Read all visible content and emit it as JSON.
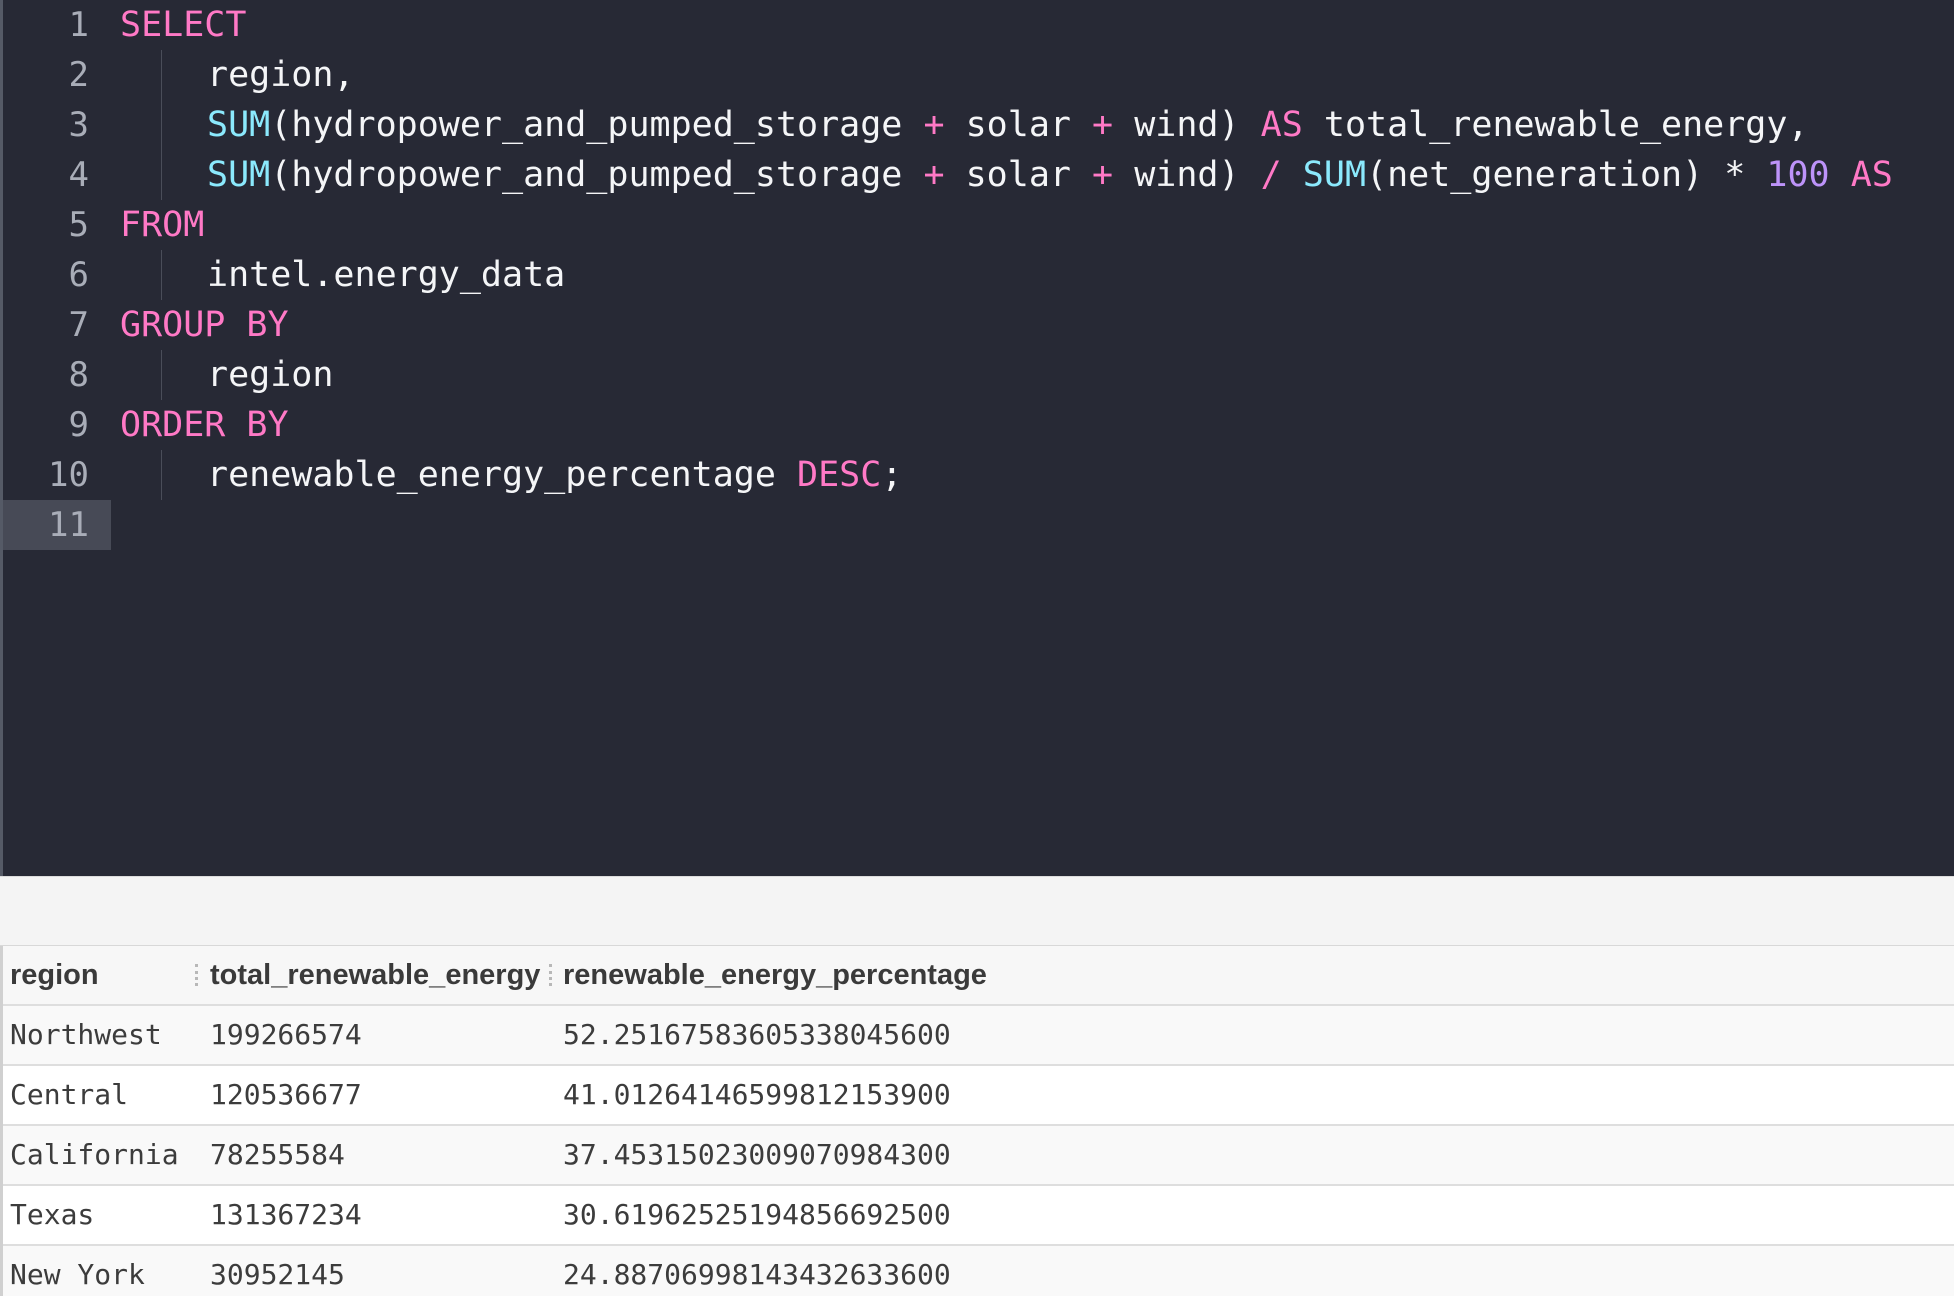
{
  "editor": {
    "active_line": 11,
    "lines": [
      {
        "n": "1",
        "tokens": [
          {
            "t": "kw",
            "v": "SELECT"
          }
        ]
      },
      {
        "n": "2",
        "indent": true,
        "tokens": [
          {
            "t": "plain",
            "v": "region,"
          }
        ]
      },
      {
        "n": "3",
        "indent": true,
        "tokens": [
          {
            "t": "fn",
            "v": "SUM"
          },
          {
            "t": "plain",
            "v": "(hydropower_and_pumped_storage "
          },
          {
            "t": "op",
            "v": "+"
          },
          {
            "t": "plain",
            "v": " solar "
          },
          {
            "t": "op",
            "v": "+"
          },
          {
            "t": "plain",
            "v": " wind) "
          },
          {
            "t": "kw",
            "v": "AS"
          },
          {
            "t": "plain",
            "v": " total_renewable_energy,"
          }
        ]
      },
      {
        "n": "4",
        "indent": true,
        "tokens": [
          {
            "t": "fn",
            "v": "SUM"
          },
          {
            "t": "plain",
            "v": "(hydropower_and_pumped_storage "
          },
          {
            "t": "op",
            "v": "+"
          },
          {
            "t": "plain",
            "v": " solar "
          },
          {
            "t": "op",
            "v": "+"
          },
          {
            "t": "plain",
            "v": " wind) "
          },
          {
            "t": "op",
            "v": "/"
          },
          {
            "t": "plain",
            "v": " "
          },
          {
            "t": "fn",
            "v": "SUM"
          },
          {
            "t": "plain",
            "v": "(net_generation) * "
          },
          {
            "t": "num",
            "v": "100"
          },
          {
            "t": "plain",
            "v": " "
          },
          {
            "t": "kw",
            "v": "AS"
          }
        ]
      },
      {
        "n": "5",
        "tokens": [
          {
            "t": "kw",
            "v": "FROM"
          }
        ]
      },
      {
        "n": "6",
        "indent": true,
        "tokens": [
          {
            "t": "plain",
            "v": "intel.energy_data"
          }
        ]
      },
      {
        "n": "7",
        "tokens": [
          {
            "t": "kw",
            "v": "GROUP BY"
          }
        ]
      },
      {
        "n": "8",
        "indent": true,
        "tokens": [
          {
            "t": "plain",
            "v": "region"
          }
        ]
      },
      {
        "n": "9",
        "tokens": [
          {
            "t": "kw",
            "v": "ORDER BY"
          }
        ]
      },
      {
        "n": "10",
        "indent": true,
        "tokens": [
          {
            "t": "plain",
            "v": "renewable_energy_percentage "
          },
          {
            "t": "kw",
            "v": "DESC"
          },
          {
            "t": "plain",
            "v": ";"
          }
        ]
      },
      {
        "n": "11",
        "tokens": []
      }
    ]
  },
  "results": {
    "columns": [
      "region",
      "total_renewable_energy",
      "renewable_energy_percentage"
    ],
    "rows": [
      [
        "Northwest",
        "199266574",
        "52.25167583605338045600"
      ],
      [
        "Central",
        "120536677",
        "41.01264146599812153900"
      ],
      [
        "California",
        "78255584",
        "37.45315023009070984300"
      ],
      [
        "Texas",
        "131367234",
        "30.61962525194856692500"
      ],
      [
        "New York",
        "30952145",
        "24.88706998143432633600"
      ]
    ]
  },
  "colors": {
    "editor_bg": "#272935",
    "keyword": "#ff79c6",
    "function": "#8be9fd",
    "number": "#bd93f9",
    "text": "#f4f5f7"
  }
}
